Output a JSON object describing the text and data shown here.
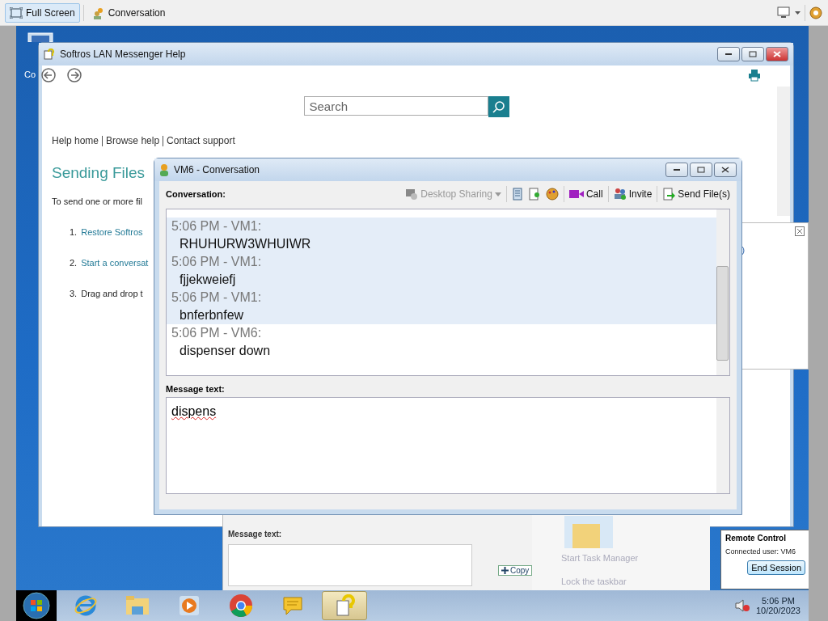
{
  "viewer_toolbar": {
    "buttons": [
      {
        "label": "Full Screen",
        "kind": "fullscreen",
        "selected": true
      },
      {
        "label": "Conversation",
        "kind": "conversation",
        "selected": false
      }
    ]
  },
  "desktop_icon": {
    "label": "Co"
  },
  "help_window": {
    "title": "Softros LAN Messenger Help",
    "search": {
      "placeholder": "Search"
    },
    "nav_links": [
      "Help home",
      "Browse help",
      "Contact support"
    ],
    "heading": "Sending Files",
    "intro": "To send one or more fil",
    "steps": [
      {
        "number": "1.",
        "text": "Restore Softros",
        "link": true
      },
      {
        "number": "2.",
        "text": "Start a conversat",
        "link": true
      },
      {
        "number": "3.",
        "text": "Drag and drop t",
        "link": false
      }
    ]
  },
  "conversation_window": {
    "title": "VM6 - Conversation",
    "label": "Conversation:",
    "tools": [
      {
        "label": "Desktop Sharing",
        "kind": "sharing",
        "disabled": true
      },
      {
        "label": "Call",
        "kind": "call",
        "disabled": false
      },
      {
        "label": "Invite",
        "kind": "invite",
        "disabled": false
      },
      {
        "label": "Send File(s)",
        "kind": "send",
        "disabled": false
      }
    ],
    "messages": [
      {
        "header": "5:06 PM - VM1:",
        "text": "RHUHURW3WHUIWR",
        "selected": true
      },
      {
        "header": "5:06 PM - VM1:",
        "text": "fjjekweiefj",
        "selected": true
      },
      {
        "header": "5:06 PM - VM1:",
        "text": "bnferbnfew",
        "selected": true
      },
      {
        "header": "5:06 PM - VM6:",
        "text": "dispenser down",
        "selected": false
      }
    ],
    "message_label": "Message text:",
    "message_value": "dispens"
  },
  "background_fragments": {
    "message_label": "Message text:",
    "drag_tag": "Copy",
    "menu_items": [
      "Start Task Manager",
      "Lock the taskbar"
    ]
  },
  "remote_control": {
    "title": "Remote Control",
    "status": "Connected user: VM6",
    "button": "End Session"
  },
  "taskbar": {
    "apps": [
      {
        "kind": "browser",
        "selected": false
      },
      {
        "kind": "folder",
        "selected": false
      },
      {
        "kind": "media",
        "selected": false
      },
      {
        "kind": "chrome",
        "selected": false
      },
      {
        "kind": "messenger",
        "selected": false
      },
      {
        "kind": "help",
        "selected": true
      }
    ]
  },
  "clock": {
    "time": "5:06 PM",
    "date": "10/20/2023"
  }
}
